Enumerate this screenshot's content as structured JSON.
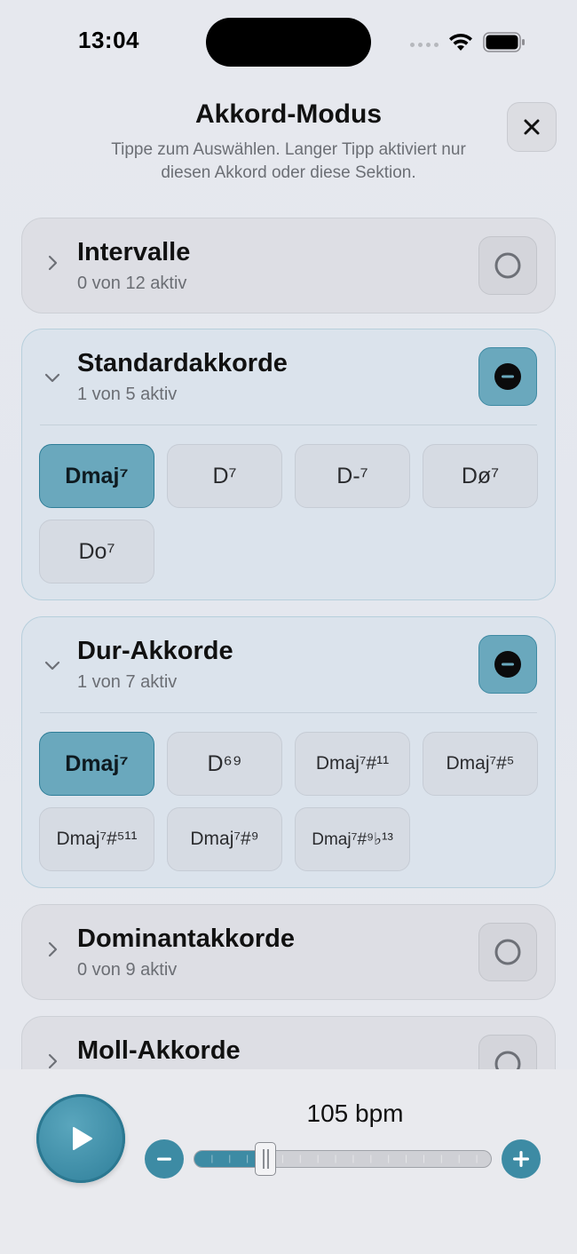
{
  "status_bar": {
    "time": "13:04"
  },
  "header": {
    "title": "Akkord-Modus",
    "subtitle": "Tippe zum Auswählen. Langer Tipp aktiviert nur diesen Akkord oder diese Sektion."
  },
  "sections": [
    {
      "title": "Intervalle",
      "count": "0 von 12 aktiv",
      "expanded": false,
      "state": "none"
    },
    {
      "title": "Standardakkorde",
      "count": "1 von 5 aktiv",
      "expanded": true,
      "state": "partial",
      "chords": [
        {
          "label": "Dmaj⁷",
          "active": true
        },
        {
          "label": "D⁷",
          "active": false
        },
        {
          "label": "D-⁷",
          "active": false
        },
        {
          "label": "Dø⁷",
          "active": false
        },
        {
          "label": "Do⁷",
          "active": false
        }
      ]
    },
    {
      "title": "Dur-Akkorde",
      "count": "1 von 7 aktiv",
      "expanded": true,
      "state": "partial",
      "chords": [
        {
          "label": "Dmaj⁷",
          "active": true
        },
        {
          "label": "D⁶⁹",
          "active": false
        },
        {
          "label": "Dmaj⁷#¹¹",
          "active": false
        },
        {
          "label": "Dmaj⁷#⁵",
          "active": false
        },
        {
          "label": "Dmaj⁷#⁵¹¹",
          "active": false
        },
        {
          "label": "Dmaj⁷#⁹",
          "active": false
        },
        {
          "label": "Dmaj⁷#⁹♭¹³",
          "active": false
        }
      ]
    },
    {
      "title": "Dominantakkorde",
      "count": "0 von 9 aktiv",
      "expanded": false,
      "state": "none"
    },
    {
      "title": "Moll-Akkorde",
      "count": "",
      "expanded": false,
      "state": "none"
    }
  ],
  "tempo": {
    "bpm_label": "105 bpm",
    "slider_fraction": 0.24
  },
  "colors": {
    "accent": "#3d8ba4",
    "accent_light": "#6aa8bd"
  },
  "icons": {
    "close": "close-icon",
    "play": "play-icon",
    "minus": "minus-icon",
    "plus": "plus-icon",
    "chevron_right": "chevron-right-icon",
    "chevron_down": "chevron-down-icon"
  }
}
